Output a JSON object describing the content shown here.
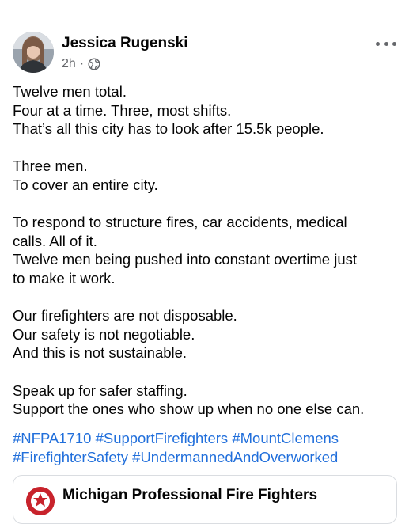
{
  "post": {
    "author": "Jessica Rugenski",
    "timestamp": "2h",
    "separator": "·",
    "audience_icon": "globe-icon",
    "paragraphs": [
      [
        "Twelve men total.",
        "Four at a time. Three, most shifts.",
        "That’s all this city has to look after 15.5k people."
      ],
      [
        "Three men.",
        "To cover an entire city."
      ],
      [
        "To respond to structure fires, car accidents, medical",
        "calls. All of it.",
        "Twelve men being pushed into constant overtime just",
        "to make it work."
      ],
      [
        "Our firefighters are not disposable.",
        "Our safety is not negotiable.",
        "And this is not sustainable."
      ],
      [
        "Speak up for safer staffing.",
        "Support the ones who show up when no one else can."
      ]
    ],
    "hashtags": [
      [
        "#NFPA1710",
        "#SupportFirefighters",
        "#MountClemens"
      ],
      [
        "#FirefighterSafety",
        "#UndermannedAndOverworked"
      ]
    ]
  },
  "shared_card": {
    "title": "Michigan Professional Fire Fighters",
    "logo_icon": "fire-department-logo-icon"
  },
  "colors": {
    "text": "#050505",
    "secondary": "#65676b",
    "link": "#216fdb",
    "card_border": "#dadde1"
  }
}
